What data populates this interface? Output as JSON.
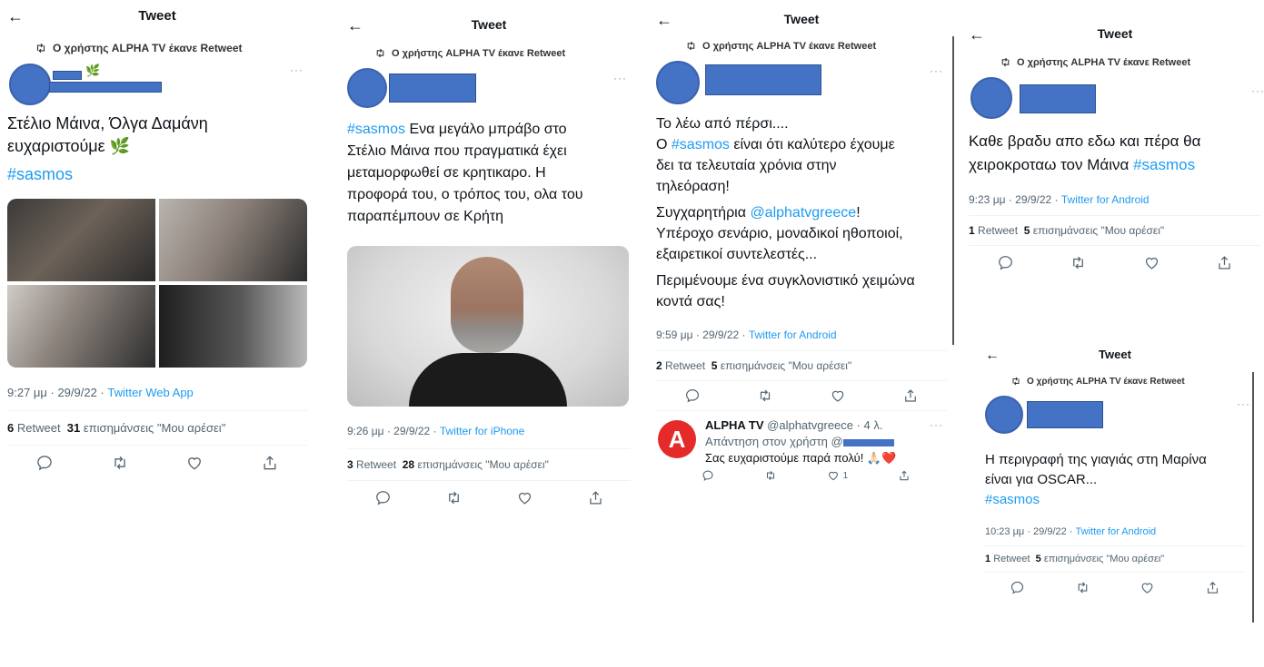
{
  "common": {
    "back": "←",
    "title": "Tweet",
    "retweet_by": "Ο χρήστης ALPHA TV έκανε Retweet",
    "more": "···",
    "retweets_word": "Retweet",
    "likes_word": "επισημάνσεις \"Μου αρέσει\""
  },
  "t1": {
    "emoji": "🌿",
    "line1": "Στέλιο Μάινα, Όλγα Δαμάνη",
    "line2": "ευχαριστούμε 🌿",
    "tag": "#sasmos",
    "time": "9:27 μμ · 29/9/22 · ",
    "source": "Twitter Web App",
    "retweets": "6",
    "likes": "31"
  },
  "t2": {
    "tag": "#sasmos",
    "text1": " Ενα μεγάλο μπράβο στο",
    "text2": "Στέλιο Μάινα  που πραγματικά έχει",
    "text3": "μεταμορφωθεί σε κρητικαρο. Η",
    "text4": "προφορά του, ο τρόπος του, ολα του",
    "text5": "παραπέμπουν σε Κρήτη",
    "time": "9:26 μμ · 29/9/22 · ",
    "source": "Twitter for iPhone",
    "retweets": "3",
    "likes": "28"
  },
  "t3": {
    "l1": "Το λέω από πέρσι....",
    "l2a": "Ο ",
    "l2tag": "#sasmos",
    "l2b": " είναι ότι καλύτερο έχουμε",
    "l3": "δει τα τελευταία χρόνια στην",
    "l4": "τηλεόραση!",
    "l5a": "Συγχαρητήρια ",
    "l5mention": "@alphatvgreece",
    "l5b": "!",
    "l6": "Υπέροχο σενάριο, μοναδικοί ηθοποιοί,",
    "l7": "εξαιρετικοί συντελεστές...",
    "l8": "Περιμένουμε ένα συγκλονιστικό χειμώνα",
    "l9": "κοντά σας!",
    "time": "9:59 μμ · 29/9/22 · ",
    "source": "Twitter for Android",
    "retweets": "2",
    "likes": "5",
    "reply": {
      "name": "ALPHA TV",
      "handle": " @alphatvgreece · 4 λ.",
      "replying": "Απάντηση στον χρήστη @",
      "text": "Σας ευχαριστούμε παρά πολύ! 🙏🏻❤️",
      "like_count": "1"
    }
  },
  "t4": {
    "l1": "Καθε βραδυ απο εδω και πέρα θα",
    "l2a": "χειροκροταω τον Μάινα ",
    "l2tag": "#sasmos",
    "time": "9:23 μμ · 29/9/22 · ",
    "source": "Twitter for Android",
    "retweets": "1",
    "likes": "5"
  },
  "t5": {
    "l1": "Η περιγραφή της γιαγιάς στη Μαρίνα",
    "l2": "είναι για OSCAR...",
    "tag": "#sasmos",
    "time": "10:23 μμ · 29/9/22 · ",
    "source": "Twitter for Android",
    "retweets": "1",
    "likes": "5"
  }
}
